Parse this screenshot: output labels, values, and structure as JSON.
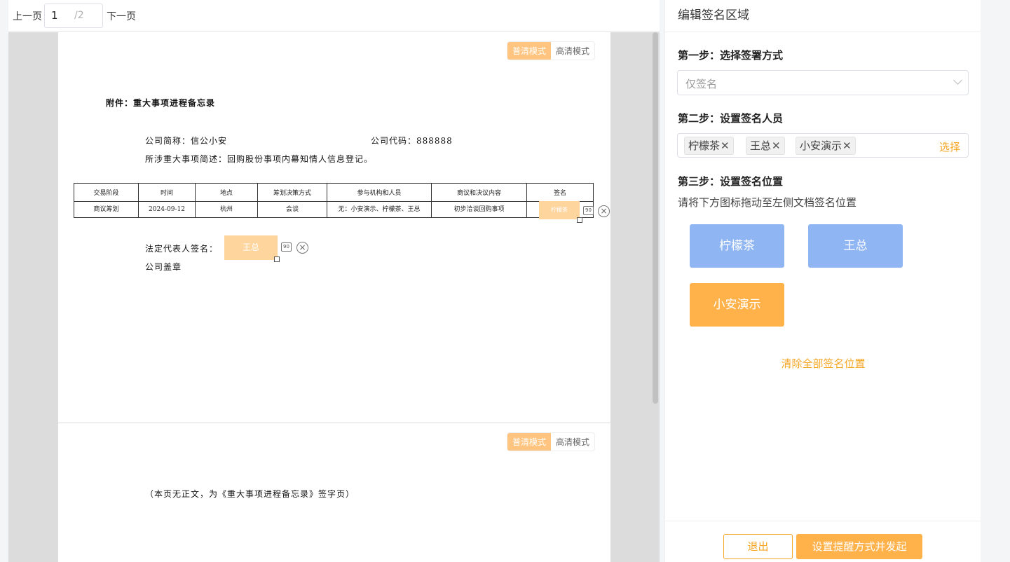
{
  "pager": {
    "prev": "上一页",
    "current": "1",
    "total": "/2",
    "next": "下一页"
  },
  "modes": {
    "normal": "普清模式",
    "hd": "高清模式"
  },
  "document": {
    "title": "附件：重大事项进程备忘录",
    "company_short": "公司简称：信公小安",
    "company_code": "公司代码：888888",
    "description": "所涉重大事项简述：回购股份事项内幕知情人信息登记。",
    "table": {
      "headers": [
        "交易阶段",
        "时间",
        "地点",
        "筹划决策方式",
        "参与机构和人员",
        "商议和决议内容",
        "签名"
      ],
      "row": [
        "商议筹划",
        "2024-09-12",
        "杭州",
        "会谈",
        "无：小安演示、柠檬茶、王总",
        "初步洽谈回购事项",
        ""
      ]
    },
    "legal_rep_label": "法定代表人签名：",
    "seal_label": "公司盖章",
    "page2_note": "（本页无正文，为《重大事项进程备忘录》签字页）",
    "sig_table": "柠檬茶",
    "sig_legal": "王总",
    "rotate_label": "90"
  },
  "panel": {
    "title": "编辑签名区域",
    "step1": "第一步：选择签署方式",
    "sign_mode": "仅签名",
    "step2": "第二步：设置签名人员",
    "signers": [
      "柠檬茶",
      "王总",
      "小安演示"
    ],
    "choose": "选择",
    "step3": "第三步：设置签名位置",
    "hint": "请将下方图标拖动至左侧文档签名位置",
    "drag_items": [
      "柠檬茶",
      "王总",
      "小安演示"
    ],
    "clear_all": "清除全部签名位置",
    "exit": "退出",
    "submit": "设置提醒方式并发起"
  }
}
